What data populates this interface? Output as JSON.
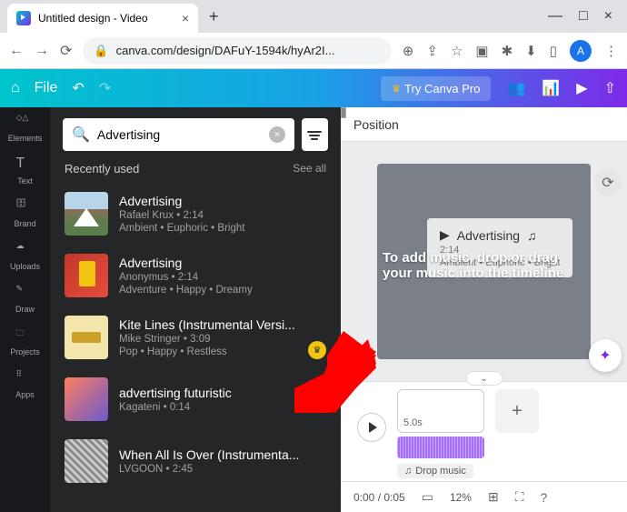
{
  "browser": {
    "tab_title": "Untitled design - Video",
    "url": "canva.com/design/DAFuY-1594k/hyAr2I...",
    "avatar_initial": "A"
  },
  "topbar": {
    "file": "File",
    "try_pro": "Try Canva Pro"
  },
  "rail": {
    "elements": "Elements",
    "text": "Text",
    "brand": "Brand",
    "uploads": "Uploads",
    "draw": "Draw",
    "projects": "Projects",
    "apps": "Apps"
  },
  "panel": {
    "search_value": "Advertising",
    "section": "Recently used",
    "see_all": "See all",
    "tracks": [
      {
        "title": "Advertising",
        "artist": "Rafael Krux",
        "dur": "2:14",
        "tags": "Ambient • Euphoric • Bright",
        "thumb": "mountain"
      },
      {
        "title": "Advertising",
        "artist": "Anonymus",
        "dur": "2:14",
        "tags": "Adventure • Happy • Dreamy",
        "thumb": "red"
      },
      {
        "title": "Kite Lines (Instrumental Versi...",
        "artist": "Mike Stringer",
        "dur": "3:09",
        "tags": "Pop • Happy • Restless",
        "thumb": "yellow",
        "pro": true
      },
      {
        "title": "advertising futuristic",
        "artist": "Kagateni",
        "dur": "0:14",
        "tags": "",
        "thumb": "grad"
      },
      {
        "title": "When All Is Over (Instrumenta...",
        "artist": "LVGOON",
        "dur": "2:45",
        "tags": "",
        "thumb": "abstract"
      }
    ]
  },
  "canvas": {
    "position": "Position",
    "drop_hint": "To add music, drop or drag your music into the timeline",
    "card_title": "Advertising",
    "card_dur": "2:14",
    "card_meta": "Ambient • Euphoric • Bright"
  },
  "timeline": {
    "clip_dur": "5.0s",
    "drop_music": "Drop music"
  },
  "status": {
    "time": "0:00 / 0:05",
    "zoom": "12%"
  }
}
